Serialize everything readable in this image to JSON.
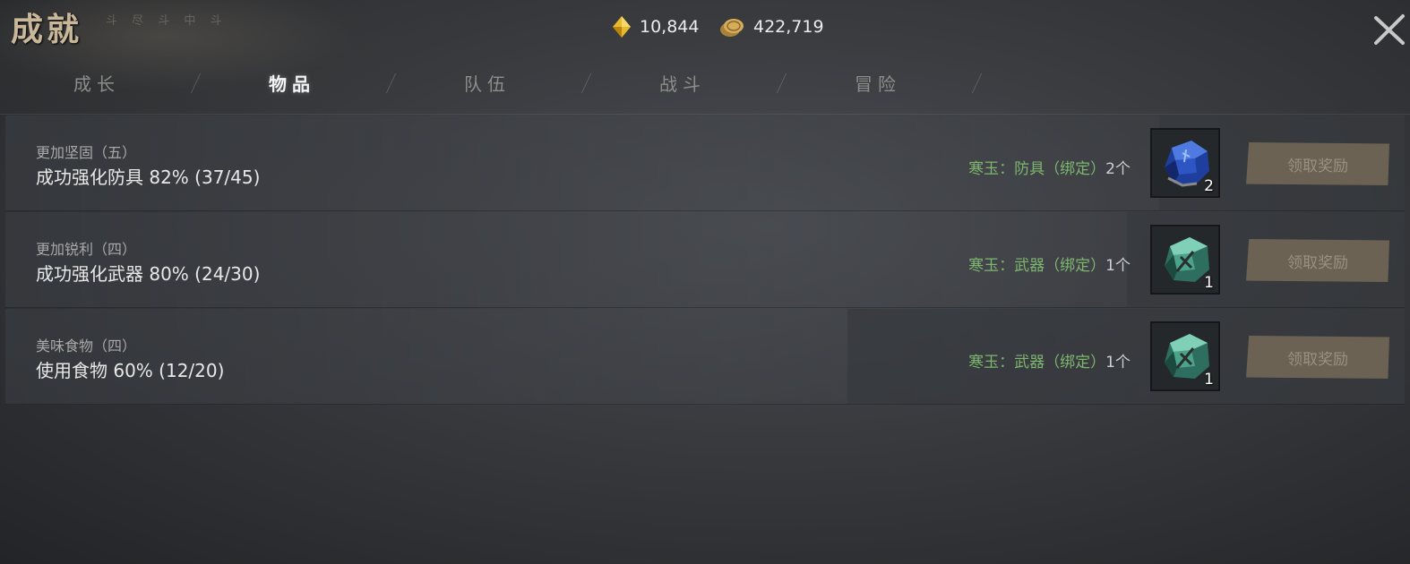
{
  "header": {
    "title": "成就",
    "subtitle": "斗 尽 斗 中 斗"
  },
  "currencies": [
    {
      "icon": "gold-gem-icon",
      "value": "10,844"
    },
    {
      "icon": "coin-stack-icon",
      "value": "422,719"
    }
  ],
  "tabs": [
    {
      "label": "成长",
      "active": false
    },
    {
      "label": "物品",
      "active": true
    },
    {
      "label": "队伍",
      "active": false
    },
    {
      "label": "战斗",
      "active": false
    },
    {
      "label": "冒险",
      "active": false
    }
  ],
  "achievements": [
    {
      "name": "更加坚固（五）",
      "progress_text": "成功强化防具 82% (37/45)",
      "progress_percent": 82,
      "reward_name": "寒玉：防具（绑定）",
      "reward_count": "2个",
      "item_icon": "blue-jade-armor-icon",
      "item_qty": "2",
      "button": "领取奖励"
    },
    {
      "name": "更加锐利（四）",
      "progress_text": "成功强化武器 80% (24/30)",
      "progress_percent": 80,
      "reward_name": "寒玉：武器（绑定）",
      "reward_count": "1个",
      "item_icon": "green-jade-weapon-icon",
      "item_qty": "1",
      "button": "领取奖励"
    },
    {
      "name": "美味食物（四）",
      "progress_text": "使用食物 60% (12/20)",
      "progress_percent": 60,
      "reward_name": "寒玉：武器（绑定）",
      "reward_count": "1个",
      "item_icon": "green-jade-weapon-icon",
      "item_qty": "1",
      "button": "领取奖励"
    }
  ]
}
